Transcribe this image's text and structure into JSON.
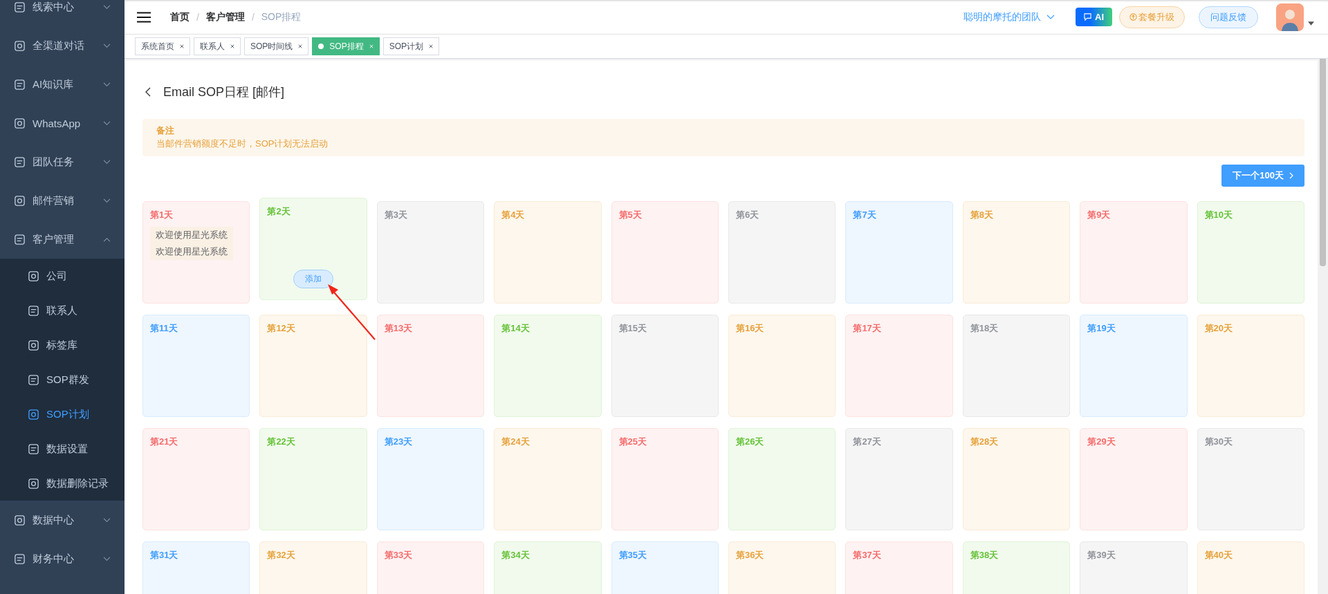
{
  "sidebar": {
    "items": [
      {
        "label": "线索中心",
        "expanded": false
      },
      {
        "label": "全渠道对话",
        "expanded": false
      },
      {
        "label": "AI知识库",
        "expanded": false
      },
      {
        "label": "WhatsApp",
        "expanded": false
      },
      {
        "label": "团队任务",
        "expanded": false
      },
      {
        "label": "邮件营销",
        "expanded": false
      },
      {
        "label": "客户管理",
        "expanded": true,
        "children": [
          {
            "label": "公司",
            "selected": false
          },
          {
            "label": "联系人",
            "selected": false
          },
          {
            "label": "标签库",
            "selected": false
          },
          {
            "label": "SOP群发",
            "selected": false
          },
          {
            "label": "SOP计划",
            "selected": true
          },
          {
            "label": "数据设置",
            "selected": false
          },
          {
            "label": "数据删除记录",
            "selected": false
          }
        ]
      },
      {
        "label": "数据中心",
        "expanded": false
      },
      {
        "label": "财务中心",
        "expanded": false
      }
    ]
  },
  "header": {
    "breadcrumb_separator": "/",
    "breadcrumb": [
      {
        "label": "首页",
        "current": false
      },
      {
        "label": "客户管理",
        "current": false
      },
      {
        "label": "SOP排程",
        "current": true
      }
    ],
    "team": "聪明的摩托的团队",
    "ai_button": "AI",
    "upgrade_button": "套餐升级",
    "feedback_button": "问题反馈"
  },
  "tabs": [
    {
      "label": "系统首页",
      "selected": false
    },
    {
      "label": "联系人",
      "selected": false
    },
    {
      "label": "SOP时间线",
      "selected": false
    },
    {
      "label": "SOP排程",
      "selected": true
    },
    {
      "label": "SOP计划",
      "selected": false
    }
  ],
  "page": {
    "title": "Email SOP日程 [邮件]",
    "note_title": "备注",
    "note_text": "当邮件营销额度不足时，SOP计划无法启动",
    "next_button": "下一个100天"
  },
  "days": [
    {
      "label": "第1天",
      "color": "#f56c6c",
      "items": [
        "欢迎使用星光系统",
        "欢迎使用星光系统"
      ]
    },
    {
      "label": "第2天",
      "color": "#67c23a",
      "add_button": "添加"
    },
    {
      "label": "第3天",
      "color": "#909399"
    },
    {
      "label": "第4天",
      "color": "#e6a23c"
    },
    {
      "label": "第5天",
      "color": "#f56c6c"
    },
    {
      "label": "第6天",
      "color": "#909399"
    },
    {
      "label": "第7天",
      "color": "#409eff"
    },
    {
      "label": "第8天",
      "color": "#e6a23c"
    },
    {
      "label": "第9天",
      "color": "#f56c6c"
    },
    {
      "label": "第10天",
      "color": "#67c23a"
    },
    {
      "label": "第11天",
      "color": "#409eff"
    },
    {
      "label": "第12天",
      "color": "#e6a23c"
    },
    {
      "label": "第13天",
      "color": "#f56c6c"
    },
    {
      "label": "第14天",
      "color": "#67c23a"
    },
    {
      "label": "第15天",
      "color": "#909399"
    },
    {
      "label": "第16天",
      "color": "#e6a23c"
    },
    {
      "label": "第17天",
      "color": "#f56c6c"
    },
    {
      "label": "第18天",
      "color": "#909399"
    },
    {
      "label": "第19天",
      "color": "#409eff"
    },
    {
      "label": "第20天",
      "color": "#e6a23c"
    },
    {
      "label": "第21天",
      "color": "#f56c6c"
    },
    {
      "label": "第22天",
      "color": "#67c23a"
    },
    {
      "label": "第23天",
      "color": "#409eff"
    },
    {
      "label": "第24天",
      "color": "#e6a23c"
    },
    {
      "label": "第25天",
      "color": "#f56c6c"
    },
    {
      "label": "第26天",
      "color": "#67c23a"
    },
    {
      "label": "第27天",
      "color": "#909399"
    },
    {
      "label": "第28天",
      "color": "#e6a23c"
    },
    {
      "label": "第29天",
      "color": "#f56c6c"
    },
    {
      "label": "第30天",
      "color": "#909399"
    },
    {
      "label": "第31天",
      "color": "#409eff"
    },
    {
      "label": "第32天",
      "color": "#e6a23c"
    },
    {
      "label": "第33天",
      "color": "#f56c6c"
    },
    {
      "label": "第34天",
      "color": "#67c23a"
    },
    {
      "label": "第35天",
      "color": "#409eff"
    },
    {
      "label": "第36天",
      "color": "#e6a23c"
    },
    {
      "label": "第37天",
      "color": "#f56c6c"
    },
    {
      "label": "第38天",
      "color": "#67c23a"
    },
    {
      "label": "第39天",
      "color": "#909399"
    },
    {
      "label": "第40天",
      "color": "#e6a23c"
    }
  ]
}
